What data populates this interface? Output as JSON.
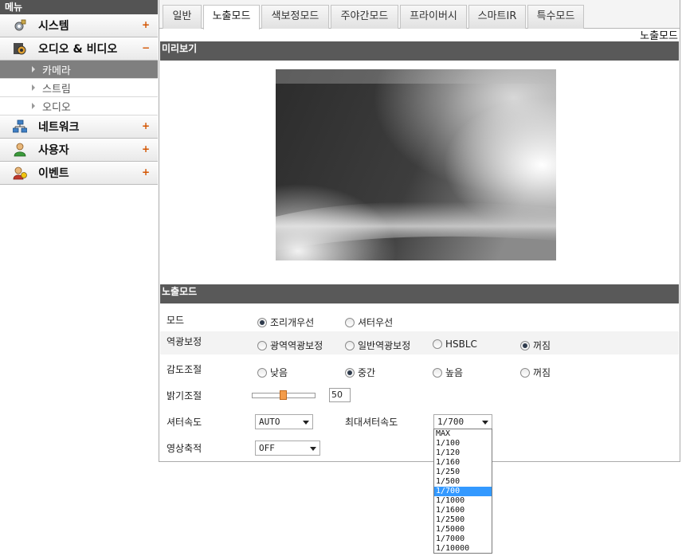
{
  "sidebar": {
    "title": "메뉴",
    "items": [
      {
        "label": "시스템",
        "toggle": "+",
        "icon": "gear-icon"
      },
      {
        "label": "오디오 & 비디오",
        "toggle": "−",
        "icon": "camera-icon"
      },
      {
        "label": "네트워크",
        "toggle": "+",
        "icon": "network-icon"
      },
      {
        "label": "사용자",
        "toggle": "+",
        "icon": "user-icon"
      },
      {
        "label": "이벤트",
        "toggle": "+",
        "icon": "event-icon"
      }
    ],
    "subitems": [
      {
        "label": "카메라",
        "active": true
      },
      {
        "label": "스트림",
        "active": false
      },
      {
        "label": "오디오",
        "active": false
      }
    ]
  },
  "tabs": [
    {
      "label": "일반"
    },
    {
      "label": "노출모드",
      "active": true
    },
    {
      "label": "색보정모드"
    },
    {
      "label": "주야간모드"
    },
    {
      "label": "프라이버시"
    },
    {
      "label": "스마트IR"
    },
    {
      "label": "특수모드"
    }
  ],
  "page_caption": "노출모드",
  "preview": {
    "title": "미리보기"
  },
  "exposure": {
    "title": "노출모드",
    "mode": {
      "label": "모드",
      "options": [
        "조리개우선",
        "셔터우선"
      ],
      "selected": 0
    },
    "backlight": {
      "label": "역광보정",
      "options": [
        "광역역광보정",
        "일반역광보정",
        "HSBLC",
        "꺼짐"
      ],
      "selected": 3
    },
    "sensitivity": {
      "label": "감도조절",
      "options": [
        "낮음",
        "중간",
        "높음",
        "꺼짐"
      ],
      "selected": 1
    },
    "brightness": {
      "label": "밝기조절",
      "value": "50",
      "fraction": 0.5
    },
    "shutter_speed": {
      "label": "셔터속도",
      "value": "AUTO"
    },
    "max_shutter": {
      "label": "최대셔터속도",
      "value": "1/700",
      "options": [
        "MAX",
        "1/100",
        "1/120",
        "1/160",
        "1/250",
        "1/500",
        "1/700",
        "1/1000",
        "1/1600",
        "1/2500",
        "1/5000",
        "1/7000",
        "1/10000"
      ],
      "selected": 6
    },
    "accumulation": {
      "label": "영상축적",
      "value": "OFF"
    }
  }
}
